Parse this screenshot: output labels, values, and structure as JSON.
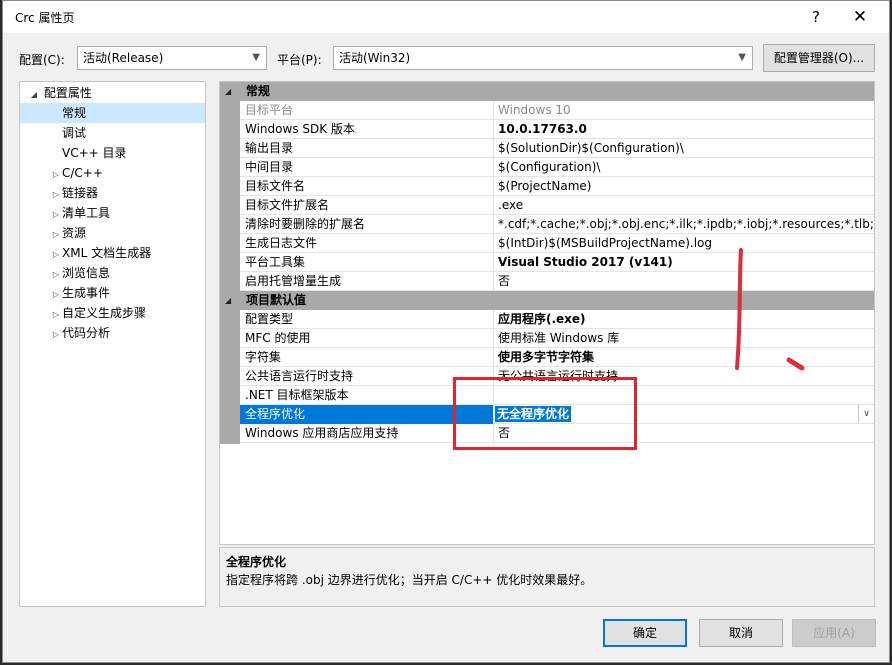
{
  "window": {
    "title": "Crc 属性页",
    "help_glyph": "?",
    "close_glyph": "✕"
  },
  "config_bar": {
    "config_label": "配置(C):",
    "config_value": "活动(Release)",
    "platform_label": "平台(P):",
    "platform_value": "活动(Win32)",
    "manager_button": "配置管理器(O)..."
  },
  "tree": {
    "root": "配置属性",
    "items": [
      {
        "label": "常规",
        "selected": true
      },
      {
        "label": "调试"
      },
      {
        "label": "VC++ 目录"
      },
      {
        "label": "C/C++"
      },
      {
        "label": "链接器"
      },
      {
        "label": "清单工具"
      },
      {
        "label": "资源"
      },
      {
        "label": "XML 文档生成器"
      },
      {
        "label": "浏览信息"
      },
      {
        "label": "生成事件"
      },
      {
        "label": "自定义生成步骤"
      },
      {
        "label": "代码分析"
      }
    ]
  },
  "grid": {
    "categories": [
      {
        "name": "常规",
        "rows": [
          {
            "name": "目标平台",
            "value": "Windows 10",
            "disabled": true
          },
          {
            "name": "Windows SDK 版本",
            "value": "10.0.17763.0",
            "bold": true
          },
          {
            "name": "输出目录",
            "value": "$(SolutionDir)$(Configuration)\\"
          },
          {
            "name": "中间目录",
            "value": "$(Configuration)\\"
          },
          {
            "name": "目标文件名",
            "value": "$(ProjectName)"
          },
          {
            "name": "目标文件扩展名",
            "value": ".exe"
          },
          {
            "name": "清除时要删除的扩展名",
            "value": "*.cdf;*.cache;*.obj;*.obj.enc;*.ilk;*.ipdb;*.iobj;*.resources;*.tlb;*.tli;*.t"
          },
          {
            "name": "生成日志文件",
            "value": "$(IntDir)$(MSBuildProjectName).log"
          },
          {
            "name": "平台工具集",
            "value": "Visual Studio 2017 (v141)",
            "bold": true
          },
          {
            "name": "启用托管增量生成",
            "value": "否"
          }
        ]
      },
      {
        "name": "项目默认值",
        "rows": [
          {
            "name": "配置类型",
            "value": "应用程序(.exe)",
            "bold": true
          },
          {
            "name": "MFC 的使用",
            "value": "使用标准 Windows 库"
          },
          {
            "name": "字符集",
            "value": "使用多字节字符集",
            "bold": true
          },
          {
            "name": "公共语言运行时支持",
            "value": "无公共语言运行时支持"
          },
          {
            "name": ".NET 目标框架版本",
            "value": ""
          },
          {
            "name": "全程序优化",
            "value": "无全程序优化",
            "selected": true
          },
          {
            "name": "Windows 应用商店应用支持",
            "value": "否"
          }
        ]
      }
    ]
  },
  "description": {
    "title": "全程序优化",
    "text": "指定程序将跨 .obj 边界进行优化；当开启 C/C++ 优化时效果最好。"
  },
  "buttons": {
    "ok": "确定",
    "cancel": "取消",
    "apply": "应用(A)"
  },
  "annotation_colors": {
    "red_box": "#e0252e",
    "red_marks": "#d9303f",
    "selection": "#0078d7"
  }
}
